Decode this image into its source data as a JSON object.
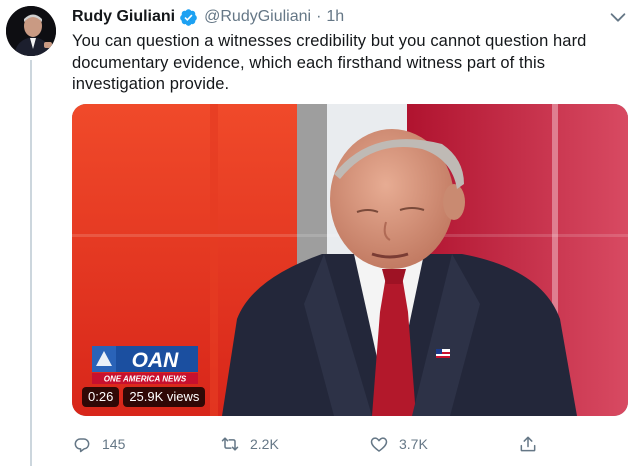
{
  "tweet": {
    "display_name": "Rudy Giuliani",
    "handle": "@RudyGiuliani",
    "separator": "·",
    "time": "1h",
    "text": "You can question a witnesses credibility but you cannot question hard documentary evidence, which each firsthand witness part of this investigation provide."
  },
  "media": {
    "logo_main": "OAN",
    "logo_sub": "ONE AMERICA NEWS",
    "duration": "0:26",
    "views": "25.9K views"
  },
  "actions": {
    "reply_count": "145",
    "retweet_count": "2.2K",
    "like_count": "3.7K"
  },
  "icons": [
    "avatar",
    "verified-badge-icon",
    "chevron-down-icon",
    "reply-icon",
    "retweet-icon",
    "like-icon",
    "share-icon"
  ],
  "colors": {
    "verified_blue": "#1da1f2",
    "muted_text": "#657786",
    "oan_blue": "#1b4fa0",
    "studio_red": "#e8321e"
  }
}
